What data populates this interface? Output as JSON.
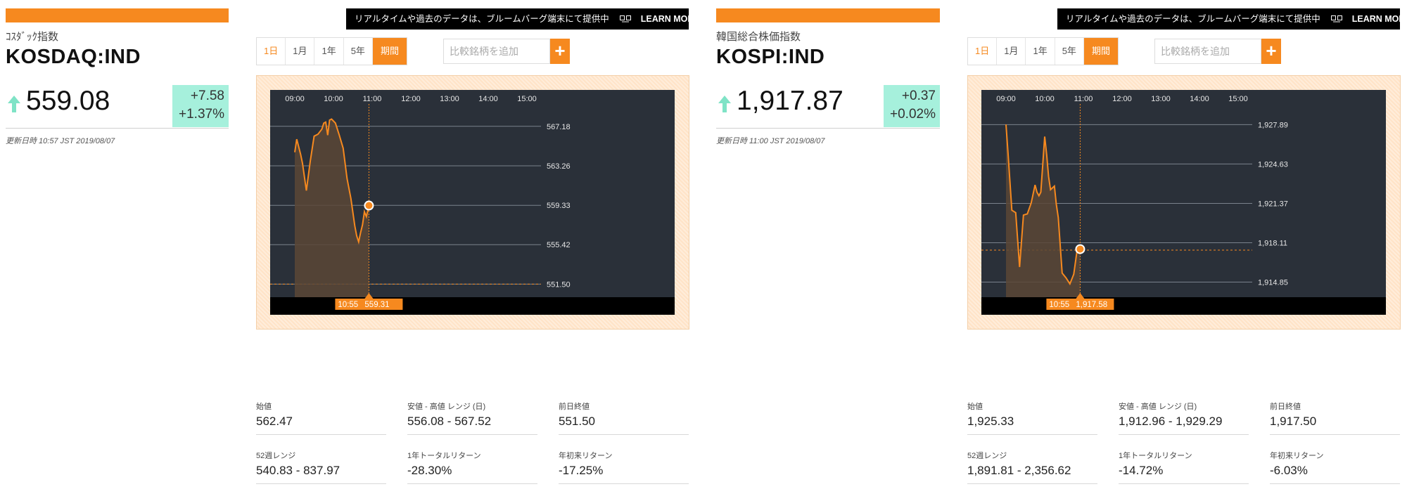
{
  "banner": {
    "text": "リアルタイムや過去のデータは、ブルームバーグ端末にて提供中",
    "learn_more": "LEARN MORE"
  },
  "tabs": [
    "1日",
    "1月",
    "1年",
    "5年",
    "期間"
  ],
  "compare_placeholder": "比較銘柄を追加",
  "plus_label": "+",
  "colors": {
    "accent": "#f6891f",
    "up": "#7fe3c6",
    "chart_bg": "#2a3039"
  },
  "stat_labels": [
    "始値",
    "安値 - 高値 レンジ (日)",
    "前日終値",
    "52週レンジ",
    "1年トータルリターン",
    "年初来リターン"
  ],
  "panels": [
    {
      "subtitle": "ｺｽﾀﾞｯｸ指数",
      "title": "KOSDAQ:IND",
      "price": "559.08",
      "change_abs": "+7.58",
      "change_pct": "+1.37%",
      "updated": "更新日時 10:57 JST 2019/08/07",
      "tooltip": {
        "time": "10:55",
        "value": "559.31"
      },
      "stats": [
        "562.47",
        "556.08 - 567.52",
        "551.50",
        "540.83 - 837.97",
        "-28.30%",
        "-17.25%"
      ]
    },
    {
      "subtitle": "韓国総合株価指数",
      "title": "KOSPI:IND",
      "price": "1,917.87",
      "change_abs": "+0.37",
      "change_pct": "+0.02%",
      "updated": "更新日時 11:00 JST 2019/08/07",
      "tooltip": {
        "time": "10:55",
        "value": "1,917.58"
      },
      "stats": [
        "1,925.33",
        "1,912.96 - 1,929.29",
        "1,917.50",
        "1,891.81 - 2,356.62",
        "-14.72%",
        "-6.03%"
      ]
    }
  ],
  "chart_data": [
    {
      "type": "area",
      "x_ticks": [
        "09:00",
        "10:00",
        "11:00",
        "12:00",
        "13:00",
        "14:00",
        "15:00"
      ],
      "y_ticks": [
        "567.18",
        "563.26",
        "559.33",
        "555.42",
        "551.50"
      ],
      "ylim": [
        550.2,
        569.4
      ],
      "grid": true,
      "reference_line": 551.5,
      "x": [
        "09:00",
        "09:03",
        "09:09",
        "09:12",
        "09:18",
        "09:24",
        "09:30",
        "09:36",
        "09:42",
        "09:45",
        "09:48",
        "09:51",
        "09:54",
        "09:57",
        "10:03",
        "10:09",
        "10:15",
        "10:21",
        "10:27",
        "10:33",
        "10:36",
        "10:39",
        "10:42",
        "10:45",
        "10:48",
        "10:51",
        "10:55"
      ],
      "y": [
        564.6,
        565.9,
        564.4,
        563.5,
        560.8,
        563.7,
        566.2,
        566.4,
        566.9,
        567.5,
        567.6,
        566.3,
        567.8,
        567.9,
        567.5,
        566.3,
        565.0,
        562.0,
        560.0,
        557.3,
        556.3,
        555.7,
        556.6,
        557.4,
        558.7,
        558.2,
        559.31
      ]
    },
    {
      "type": "area",
      "x_ticks": [
        "09:00",
        "10:00",
        "11:00",
        "12:00",
        "13:00",
        "14:00",
        "15:00"
      ],
      "y_ticks": [
        "1,927.89",
        "1,924.63",
        "1,921.37",
        "1,918.11",
        "1,914.85"
      ],
      "ylim": [
        1913.6,
        1929.6
      ],
      "grid": true,
      "reference_line": 1917.5,
      "x": [
        "09:00",
        "09:03",
        "09:09",
        "09:15",
        "09:21",
        "09:27",
        "09:33",
        "09:39",
        "09:45",
        "09:48",
        "09:51",
        "09:54",
        "10:00",
        "10:03",
        "10:06",
        "10:09",
        "10:15",
        "10:18",
        "10:21",
        "10:27",
        "10:33",
        "10:39",
        "10:45",
        "10:51",
        "10:55"
      ],
      "y": [
        1927.9,
        1925.6,
        1920.8,
        1920.6,
        1916.1,
        1920.4,
        1920.5,
        1921.4,
        1922.9,
        1922.3,
        1922.0,
        1922.3,
        1926.9,
        1925.4,
        1923.6,
        1922.5,
        1922.8,
        1921.3,
        1920.2,
        1915.6,
        1915.2,
        1914.7,
        1915.5,
        1917.8,
        1917.58
      ]
    }
  ]
}
